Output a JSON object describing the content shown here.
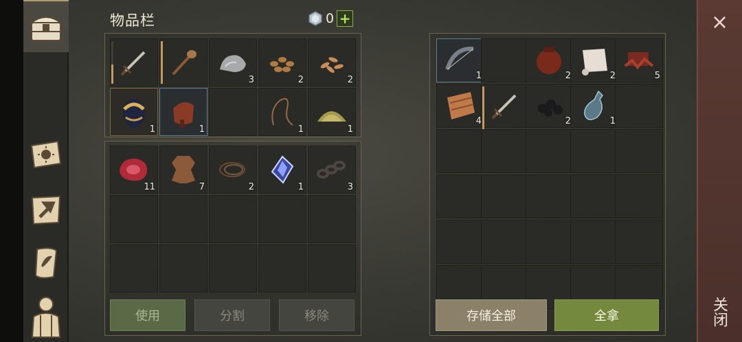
{
  "inventory": {
    "title": "物品栏",
    "currency": {
      "icon": "gem-icon",
      "value": "0",
      "add_label": "+"
    },
    "bag_rows": [
      [
        {
          "icon": "sword-icon",
          "durability": 0.45
        },
        {
          "icon": "club-icon",
          "durability": 1.0
        },
        {
          "icon": "stone-icon",
          "qty": "3"
        },
        {
          "icon": "nuts-icon",
          "qty": "2"
        },
        {
          "icon": "seeds-icon",
          "qty": "2"
        }
      ],
      [
        {
          "icon": "egg-icon",
          "qty": "1",
          "highlight": "gold"
        },
        {
          "icon": "saddle-icon",
          "qty": "1",
          "highlight": "blue"
        },
        {},
        {
          "icon": "rope-icon",
          "qty": "1"
        },
        {
          "icon": "powder-icon",
          "qty": "1"
        }
      ]
    ],
    "pocket_rows": [
      [
        {
          "icon": "meat-icon",
          "qty": "11"
        },
        {
          "icon": "hide-icon",
          "qty": "7"
        },
        {
          "icon": "fiber-rope-icon",
          "qty": "2"
        },
        {
          "icon": "crystal-icon",
          "qty": "1"
        },
        {
          "icon": "chain-icon",
          "qty": "3"
        }
      ],
      [
        {},
        {},
        {},
        {},
        {}
      ],
      [
        {},
        {},
        {},
        {},
        {}
      ]
    ],
    "buttons": {
      "use": "使用",
      "split": "分割",
      "remove": "移除"
    }
  },
  "container": {
    "rows": [
      [
        {
          "icon": "bow-icon",
          "qty": "1",
          "highlight": "blue"
        },
        {},
        {
          "icon": "pot-icon",
          "qty": "2"
        },
        {
          "icon": "scroll-icon",
          "qty": "2"
        },
        {
          "icon": "scrap-icon",
          "qty": "5"
        }
      ],
      [
        {
          "icon": "leather-icon",
          "qty": "4"
        },
        {
          "icon": "sword-icon",
          "durability": 1.0
        },
        {
          "icon": "coal-icon",
          "qty": "2"
        },
        {
          "icon": "bottle-icon",
          "qty": "1"
        },
        {}
      ],
      [
        {},
        {},
        {},
        {},
        {}
      ],
      [
        {},
        {},
        {},
        {},
        {}
      ],
      [
        {},
        {},
        {},
        {},
        {}
      ],
      [
        {},
        {},
        {},
        {},
        {}
      ]
    ],
    "buttons": {
      "store_all": "存储全部",
      "take_all": "全拿"
    }
  },
  "sidebar": [
    {
      "name": "chest-icon",
      "active": true
    },
    {
      "name": "journal-icon"
    },
    {
      "name": "crafting-icon"
    },
    {
      "name": "map-scroll-icon"
    },
    {
      "name": "character-icon"
    }
  ],
  "close": {
    "x": "×",
    "label": "关闭"
  }
}
